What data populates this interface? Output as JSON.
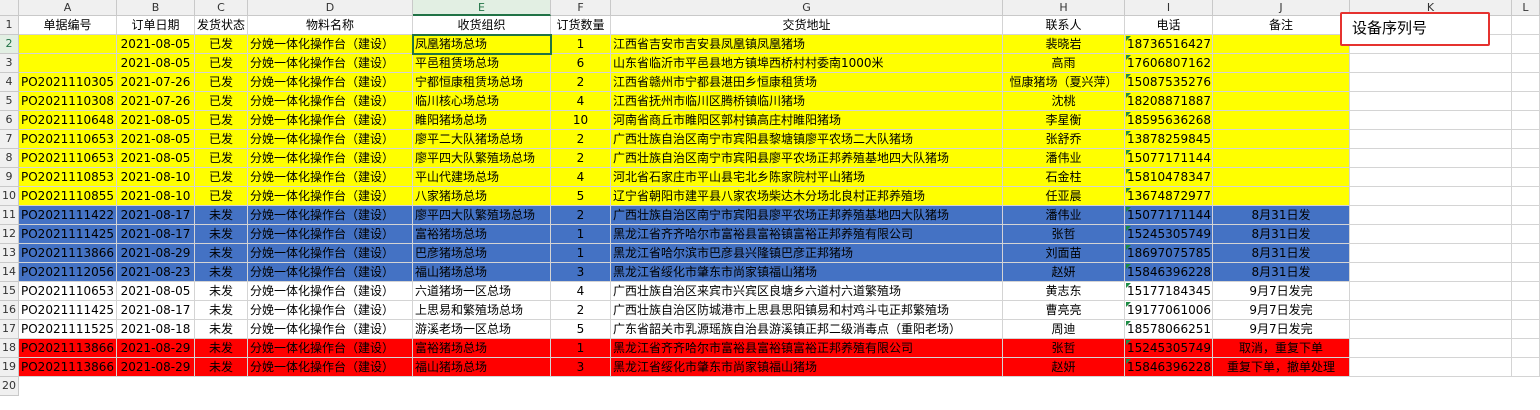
{
  "columns": [
    "A",
    "B",
    "C",
    "D",
    "E",
    "F",
    "G",
    "H",
    "I",
    "J",
    "K",
    "L"
  ],
  "selected_column": "E",
  "selected_row": 2,
  "header_row": [
    "单据编号",
    "订单日期",
    "发货状态",
    "物料名称",
    "收货组织",
    "订货数量",
    "交货地址",
    "联系人",
    "电话",
    "备注",
    "",
    ""
  ],
  "annotation_box": "设备序列号",
  "colors": {
    "yellow": "#ffff00",
    "blue": "#4472c4",
    "red": "#ff0000",
    "white": "#ffffff",
    "grid": "#d4d4d4",
    "header_bg": "#f0f0f0",
    "select": "#217346",
    "annotation_border": "#e5322f"
  },
  "rows": [
    {
      "n": "2",
      "fill": "yellow",
      "cells": [
        "",
        "2021-08-05",
        "已发",
        "分娩一体化操作台（建设）",
        "凤凰猪场总场",
        "1",
        "江西省吉安市吉安县凤凰镇凤凰猪场",
        "裴晓岩",
        "18736516427",
        "",
        ""
      ]
    },
    {
      "n": "3",
      "fill": "yellow",
      "cells": [
        "",
        "2021-08-05",
        "已发",
        "分娩一体化操作台（建设）",
        "平邑租赁场总场",
        "6",
        "山东省临沂市平邑县地方镇埠西桥村村委南1000米",
        "高雨",
        "17606807162",
        "",
        ""
      ]
    },
    {
      "n": "4",
      "fill": "yellow",
      "cells": [
        "PO2021110305",
        "2021-07-26",
        "已发",
        "分娩一体化操作台（建设）",
        "宁都恒康租赁场总场",
        "2",
        "江西省赣州市宁都县湛田乡恒康租赁场",
        "恒康猪场（夏兴萍）",
        "15087535276",
        "",
        ""
      ]
    },
    {
      "n": "5",
      "fill": "yellow",
      "cells": [
        "PO2021110308",
        "2021-07-26",
        "已发",
        "分娩一体化操作台（建设）",
        "临川核心场总场",
        "4",
        "江西省抚州市临川区腾桥镇临川猪场",
        "沈桃",
        "18208871887",
        "",
        ""
      ]
    },
    {
      "n": "6",
      "fill": "yellow",
      "cells": [
        "PO2021110648",
        "2021-08-05",
        "已发",
        "分娩一体化操作台（建设）",
        "睢阳猪场总场",
        "10",
        "河南省商丘市睢阳区郭村镇高庄村睢阳猪场",
        "李星衡",
        "18595636268",
        "",
        ""
      ]
    },
    {
      "n": "7",
      "fill": "yellow",
      "cells": [
        "PO2021110653",
        "2021-08-05",
        "已发",
        "分娩一体化操作台（建设）",
        "廖平二大队猪场总场",
        "2",
        "广西壮族自治区南宁市宾阳县黎塘镇廖平农场二大队猪场",
        "张舒乔",
        "13878259845",
        "",
        ""
      ]
    },
    {
      "n": "8",
      "fill": "yellow",
      "cells": [
        "PO2021110653",
        "2021-08-05",
        "已发",
        "分娩一体化操作台（建设）",
        "廖平四大队繁殖场总场",
        "2",
        "广西壮族自治区南宁市宾阳县廖平农场正邦养殖基地四大队猪场",
        "潘伟业",
        "15077171144",
        "",
        ""
      ]
    },
    {
      "n": "9",
      "fill": "yellow",
      "cells": [
        "PO2021110853",
        "2021-08-10",
        "已发",
        "分娩一体化操作台（建设）",
        "平山代建场总场",
        "4",
        "河北省石家庄市平山县宅北乡陈家院村平山猪场",
        "石金柱",
        "15810478347",
        "",
        ""
      ]
    },
    {
      "n": "10",
      "fill": "yellow",
      "cells": [
        "PO2021110855",
        "2021-08-10",
        "已发",
        "分娩一体化操作台（建设）",
        "八家猪场总场",
        "5",
        "辽宁省朝阳市建平县八家农场柴达木分场北良村正邦养殖场",
        "任亚晨",
        "13674872977",
        "",
        ""
      ]
    },
    {
      "n": "11",
      "fill": "blue",
      "cells": [
        "PO2021111422",
        "2021-08-17",
        "未发",
        "分娩一体化操作台（建设）",
        "廖平四大队繁殖场总场",
        "2",
        "广西壮族自治区南宁市宾阳县廖平农场正邦养殖基地四大队猪场",
        "潘伟业",
        "15077171144",
        "8月31日发",
        ""
      ]
    },
    {
      "n": "12",
      "fill": "blue",
      "cells": [
        "PO2021111425",
        "2021-08-17",
        "未发",
        "分娩一体化操作台（建设）",
        "富裕猪场总场",
        "1",
        "黑龙江省齐齐哈尔市富裕县富裕镇富裕正邦养殖有限公司",
        "张哲",
        "15245305749",
        "8月31日发",
        ""
      ]
    },
    {
      "n": "13",
      "fill": "blue",
      "cells": [
        "PO2021113866",
        "2021-08-29",
        "未发",
        "分娩一体化操作台（建设）",
        "巴彦猪场总场",
        "1",
        "黑龙江省哈尔滨市巴彦县兴隆镇巴彦正邦猪场",
        "刘面苗",
        "18697075785",
        "8月31日发",
        ""
      ]
    },
    {
      "n": "14",
      "fill": "blue",
      "cells": [
        "PO2021112056",
        "2021-08-23",
        "未发",
        "分娩一体化操作台（建设）",
        "福山猪场总场",
        "3",
        "黑龙江省绥化市肇东市尚家镇福山猪场",
        "赵妍",
        "15846396228",
        "8月31日发",
        ""
      ]
    },
    {
      "n": "15",
      "fill": "white",
      "cells": [
        "PO2021110653",
        "2021-08-05",
        "未发",
        "分娩一体化操作台（建设）",
        "六道猪场一区总场",
        "4",
        "广西壮族自治区来宾市兴宾区良塘乡六道村六道繁殖场",
        "黄志东",
        "15177184345",
        "9月7日发完",
        ""
      ]
    },
    {
      "n": "16",
      "fill": "white",
      "cells": [
        "PO2021111425",
        "2021-08-17",
        "未发",
        "分娩一体化操作台（建设）",
        "上思易和繁殖场总场",
        "2",
        "广西壮族自治区防城港市上思县思阳镇易和村鸡斗屯正邦繁殖场",
        "曹亮亮",
        "19177061006",
        "9月7日发完",
        ""
      ]
    },
    {
      "n": "17",
      "fill": "white",
      "cells": [
        "PO2021111525",
        "2021-08-18",
        "未发",
        "分娩一体化操作台（建设）",
        "游溪老场一区总场",
        "5",
        "广东省韶关市乳源瑶族自治县游溪镇正邦二级消毒点（重阳老场）",
        "周迪",
        "18578066251",
        "9月7日发完",
        ""
      ]
    },
    {
      "n": "18",
      "fill": "red",
      "cells": [
        "PO2021113866",
        "2021-08-29",
        "未发",
        "分娩一体化操作台（建设）",
        "富裕猪场总场",
        "1",
        "黑龙江省齐齐哈尔市富裕县富裕镇富裕正邦养殖有限公司",
        "张哲",
        "15245305749",
        "取消，重复下单",
        ""
      ]
    },
    {
      "n": "19",
      "fill": "red",
      "cells": [
        "PO2021113866",
        "2021-08-29",
        "未发",
        "分娩一体化操作台（建设）",
        "福山猪场总场",
        "3",
        "黑龙江省绥化市肇东市尚家镇福山猪场",
        "赵妍",
        "15846396228",
        "重复下单，撤单处理",
        ""
      ]
    }
  ]
}
